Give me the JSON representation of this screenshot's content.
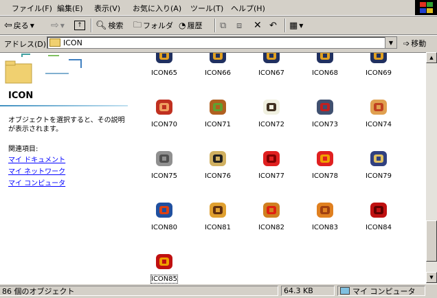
{
  "menu": [
    "ファイル(F)",
    "編集(E)",
    "表示(V)",
    "お気に入り(A)",
    "ツール(T)",
    "ヘルプ(H)"
  ],
  "toolbar": {
    "back": "戻る",
    "search": "検索",
    "folders": "フォルダ",
    "history": "履歴"
  },
  "address": {
    "label": "アドレス(D)",
    "value": "ICON",
    "go": "移動"
  },
  "left_panel": {
    "title": "ICON",
    "description": "オブジェクトを選択すると、その説明が表示されます。",
    "related_heading": "関連項目:",
    "links": [
      "マイ ドキュメント",
      "マイ ネットワーク",
      "マイ コンピュータ"
    ]
  },
  "icons": [
    {
      "label": "ICON65",
      "icon": "bomb-icon",
      "c1": "#203060",
      "c2": "#e0a020"
    },
    {
      "label": "ICON66",
      "icon": "bomb-icon",
      "c1": "#203060",
      "c2": "#e0a020"
    },
    {
      "label": "ICON67",
      "icon": "bomb-icon",
      "c1": "#203060",
      "c2": "#e0a020"
    },
    {
      "label": "ICON68",
      "icon": "bomb-icon",
      "c1": "#203060",
      "c2": "#e0a020"
    },
    {
      "label": "ICON69",
      "icon": "bomb-icon",
      "c1": "#203060",
      "c2": "#e0a020"
    },
    {
      "label": "ICON70",
      "icon": "crosshair-ball-icon",
      "c1": "#c03020",
      "c2": "#f0a060"
    },
    {
      "label": "ICON71",
      "icon": "hamburger-icon",
      "c1": "#b06020",
      "c2": "#60a030"
    },
    {
      "label": "ICON72",
      "icon": "bone-dog-icon",
      "c1": "#f0f0e0",
      "c2": "#403020"
    },
    {
      "label": "ICON73",
      "icon": "robot-icon",
      "c1": "#405070",
      "c2": "#c02020"
    },
    {
      "label": "ICON74",
      "icon": "fried-shrimp-icon",
      "c1": "#e0a050",
      "c2": "#c04020"
    },
    {
      "label": "ICON75",
      "icon": "demon-mask-icon",
      "c1": "#909090",
      "c2": "#505050"
    },
    {
      "label": "ICON76",
      "icon": "panda-icon",
      "c1": "#d0b060",
      "c2": "#202020"
    },
    {
      "label": "ICON77",
      "icon": "ten-kanji-icon",
      "c1": "#e02020",
      "c2": "#800000"
    },
    {
      "label": "ICON78",
      "icon": "p-ten-kanji-icon",
      "c1": "#e02020",
      "c2": "#f0a000"
    },
    {
      "label": "ICON79",
      "icon": "bird-icon",
      "c1": "#304080",
      "c2": "#e0c060"
    },
    {
      "label": "ICON80",
      "icon": "p-bomb-icon",
      "c1": "#2050a0",
      "c2": "#e04010"
    },
    {
      "label": "ICON81",
      "icon": "helmet-icon",
      "c1": "#e0a030",
      "c2": "#603010"
    },
    {
      "label": "ICON82",
      "icon": "p-helmet-icon",
      "c1": "#d08020",
      "c2": "#e02010"
    },
    {
      "label": "ICON83",
      "icon": "crystal-icon",
      "c1": "#e08020",
      "c2": "#a04010"
    },
    {
      "label": "ICON84",
      "icon": "satsu-kanji-icon",
      "c1": "#c01010",
      "c2": "#600000"
    },
    {
      "label": "ICON85",
      "icon": "p-satsu-kanji-icon",
      "c1": "#c01010",
      "c2": "#f0a000"
    }
  ],
  "status": {
    "count": "86 個のオブジェクト",
    "size": "64.3 KB",
    "location": "マイ コンピュータ"
  }
}
